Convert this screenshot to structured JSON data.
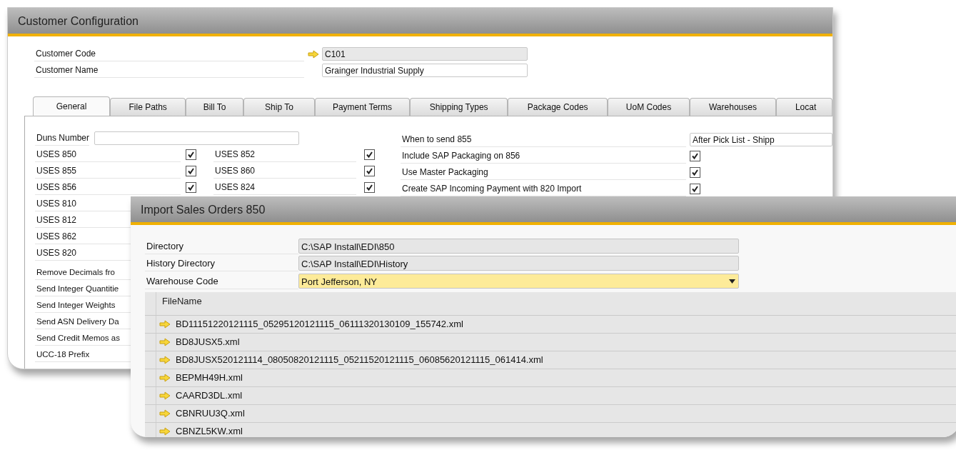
{
  "customer_window": {
    "title": "Customer Configuration",
    "header_fields": [
      {
        "label": "Customer Code",
        "value": "C101",
        "kind": "readonly",
        "link_arrow": true
      },
      {
        "label": "Customer Name",
        "value": "Grainger Industrial Supply",
        "kind": "editable",
        "link_arrow": false
      }
    ],
    "tabs": [
      {
        "label": "General",
        "selected": true
      },
      {
        "label": "File Paths",
        "selected": false
      },
      {
        "label": "Bill To",
        "selected": false
      },
      {
        "label": "Ship To",
        "selected": false
      },
      {
        "label": "Payment Terms",
        "selected": false
      },
      {
        "label": "Shipping Types",
        "selected": false
      },
      {
        "label": "Package Codes",
        "selected": false
      },
      {
        "label": "UoM Codes",
        "selected": false
      },
      {
        "label": "Warehouses",
        "selected": false
      },
      {
        "label": "Locat",
        "selected": false
      }
    ],
    "duns_label": "Duns Number",
    "uses_left": [
      {
        "label": "USES 850",
        "checked": true
      },
      {
        "label": "USES 855",
        "checked": true
      },
      {
        "label": "USES 856",
        "checked": true
      }
    ],
    "uses_left_more": [
      "USES 810",
      "USES 812",
      "USES 862",
      "USES 820"
    ],
    "uses_middle": [
      {
        "label": "USES 852",
        "checked": true
      },
      {
        "label": "USES 860",
        "checked": true
      },
      {
        "label": "USES 824",
        "checked": true
      }
    ],
    "option_labels": [
      "Remove Decimals fro",
      "Send Integer Quantitie",
      "Send Integer Weights",
      "Send ASN Delivery Da",
      "Send Credit Memos as",
      "UCC-18 Prefix"
    ],
    "send_855": {
      "label": "When to send 855",
      "value": "After Pick List - Shipp"
    },
    "right_checks": [
      {
        "label": "Include SAP Packaging on 856",
        "checked": true
      },
      {
        "label": "Use Master Packaging",
        "checked": true
      },
      {
        "label": "Create SAP Incoming Payment with 820 Import",
        "checked": true
      }
    ]
  },
  "import_window": {
    "title": "Import Sales Orders 850",
    "fields": [
      {
        "label": "Directory",
        "value": "C:\\SAP Install\\EDI\\850",
        "kind": "readonly"
      },
      {
        "label": "History Directory",
        "value": "C:\\SAP Install\\EDI\\History",
        "kind": "readonly"
      },
      {
        "label": "Warehouse Code",
        "value": "Port Jefferson, NY",
        "kind": "dropdown"
      }
    ],
    "table": {
      "columns": [
        "FileName"
      ],
      "rows": [
        "BD11151220121115_05295120121115_06111320130109_155742.xml",
        "BD8JUSX5.xml",
        "BD8JUSX520121114_08050820121115_05211520121115_06085620121115_061414.xml",
        "BEPMH49H.xml",
        "CAARD3DL.xml",
        "CBNRUU3Q.xml",
        "CBNZL5KW.xml"
      ]
    }
  }
}
